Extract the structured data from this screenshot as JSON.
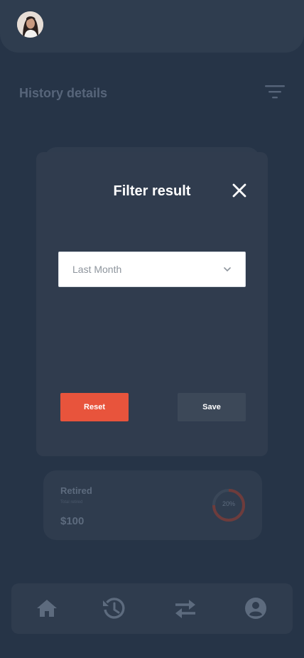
{
  "header": {
    "avatar_alt": "user avatar"
  },
  "page": {
    "title": "History details"
  },
  "modal": {
    "title": "Filter result",
    "select": {
      "value": "Last Month"
    },
    "reset_label": "Reset",
    "save_label": "Save"
  },
  "stat_card": {
    "title": "Retired",
    "subtitle": "Total retired",
    "amount": "$100",
    "progress_label": "20%",
    "progress_value": 0.2
  },
  "nav": {
    "items": [
      {
        "icon": "home-icon"
      },
      {
        "icon": "history-icon"
      },
      {
        "icon": "transfer-icon"
      },
      {
        "icon": "profile-icon"
      }
    ]
  },
  "colors": {
    "background": "#263447",
    "card": "#2f3c4e",
    "accent": "#e8543c",
    "muted_text": "#57657a"
  }
}
